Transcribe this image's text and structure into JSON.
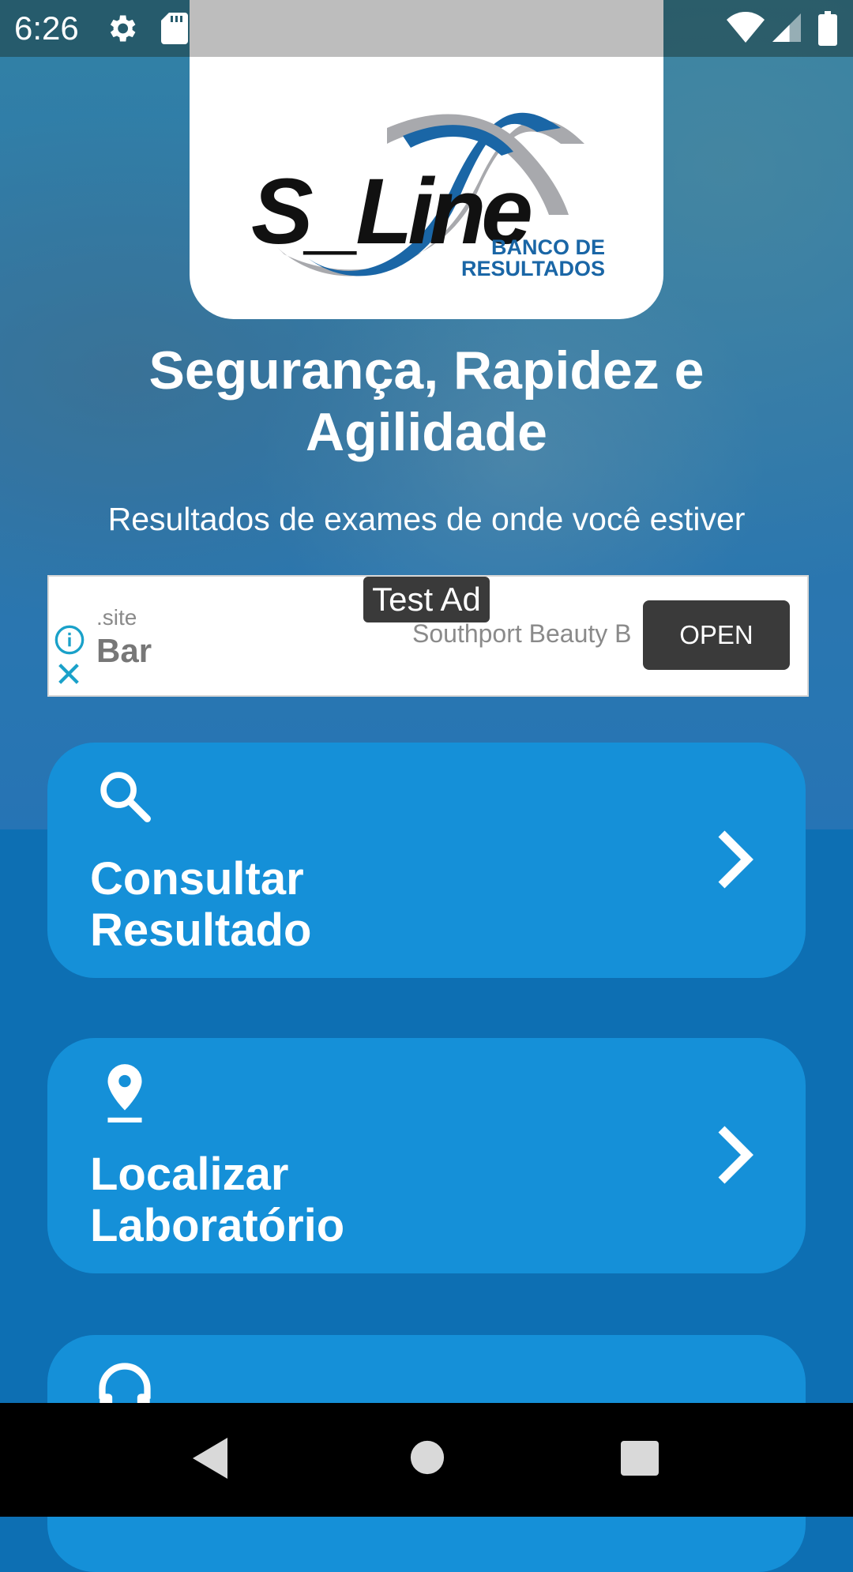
{
  "status_bar": {
    "time": "6:26",
    "icons": [
      "gear-icon",
      "sd-card-icon",
      "wifi-icon",
      "signal-icon",
      "battery-icon"
    ]
  },
  "logo": {
    "brand": "S_Line",
    "sub_line1": "BANCO DE",
    "sub_line2": "RESULTADOS"
  },
  "hero": {
    "headline_line1": "Segurança, Rapidez e",
    "headline_line2": "Agilidade",
    "subline": "Resultados de exames de onde você estiver"
  },
  "ad": {
    "label": "Test Ad",
    "site": ".site",
    "title": "Bar",
    "advertiser": "Southport Beauty B",
    "cta": "OPEN"
  },
  "menu": {
    "items": [
      {
        "line1": "Consultar",
        "line2": "Resultado",
        "icon": "search-icon"
      },
      {
        "line1": "Localizar",
        "line2": "Laboratório",
        "icon": "location-pin-icon"
      },
      {
        "line1": "",
        "line2": "",
        "icon": "headset-icon"
      }
    ]
  },
  "nav_bar": {
    "icons": [
      "back-icon",
      "home-icon",
      "recent-apps-icon"
    ]
  },
  "colors": {
    "card_blue": "#1590d8",
    "page_blue": "#0d6fb3",
    "logo_blue": "#1a66a6"
  }
}
